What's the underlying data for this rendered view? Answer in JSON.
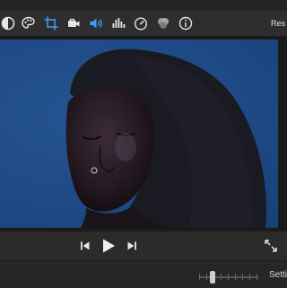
{
  "toolbar": {
    "tools": [
      {
        "icon": "color-balance-icon"
      },
      {
        "icon": "color-palette-icon"
      },
      {
        "icon": "crop-icon"
      },
      {
        "icon": "stabilization-camera-icon"
      },
      {
        "icon": "volume-icon",
        "active": true
      },
      {
        "icon": "audio-equalizer-icon"
      },
      {
        "icon": "speed-gauge-icon"
      },
      {
        "icon": "clip-filter-icon"
      },
      {
        "icon": "info-icon"
      }
    ],
    "reset_label": "Res",
    "accent_color": "#3fa0ff"
  },
  "viewer": {
    "content": "video-frame"
  },
  "playback": {
    "skip_back": "skip-back-icon",
    "play": "play-icon",
    "skip_forward": "skip-forward-icon",
    "fullscreen": "fullscreen-icon"
  },
  "bottom_bar": {
    "zoom_slider_value": 0.2,
    "settings_label": "Setti"
  }
}
